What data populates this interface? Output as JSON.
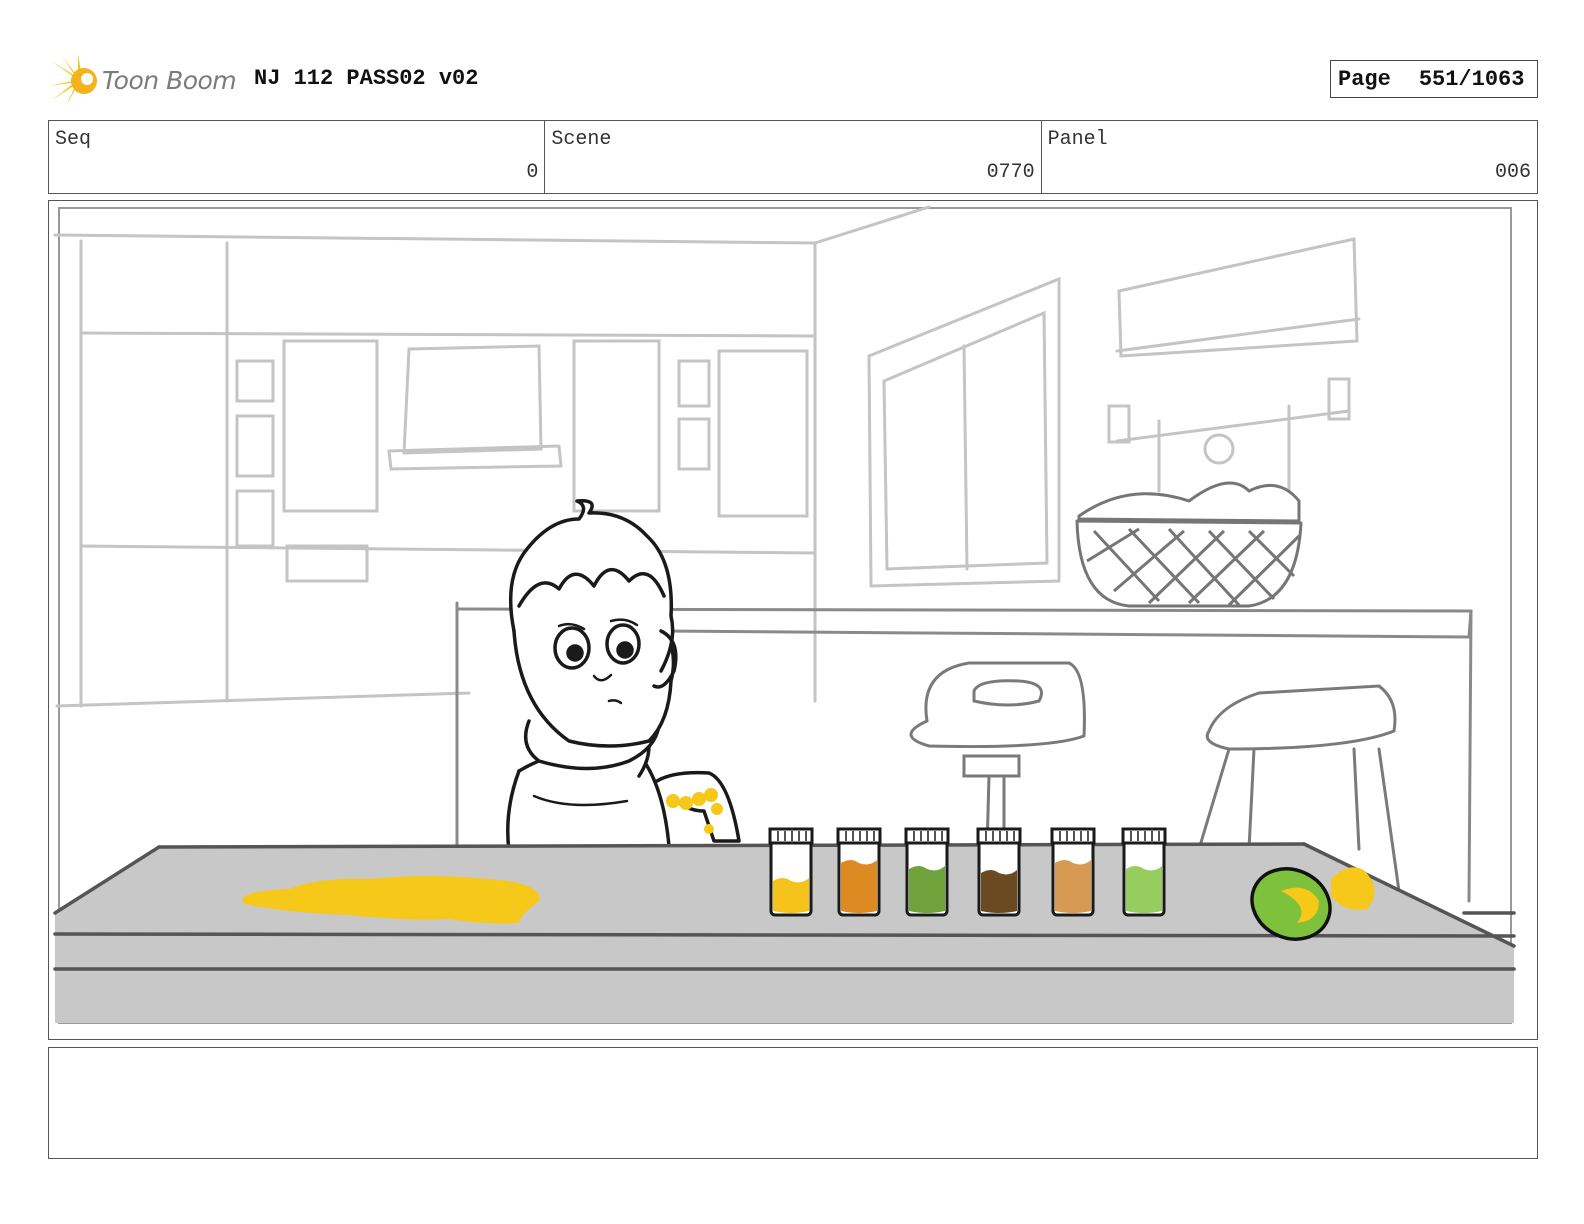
{
  "header": {
    "logo_text": "Toon Boom",
    "project_title": "NJ 112 PASS02 v02",
    "page_label": "Page",
    "page_number": "551/1063"
  },
  "info": {
    "seq_label": "Seq",
    "seq_value": "0",
    "scene_label": "Scene",
    "scene_value": "0770",
    "panel_label": "Panel",
    "panel_value": "006"
  },
  "panel": {
    "jar_colors": [
      "#f6c21c",
      "#de8a23",
      "#6fa23a",
      "#6b4a22",
      "#d79a52",
      "#97cc5e"
    ],
    "spill_color": "#f5c81a",
    "lime_color": "#7dc13c",
    "counter_color": "#c8c8c8"
  },
  "notes": {
    "text": ""
  }
}
